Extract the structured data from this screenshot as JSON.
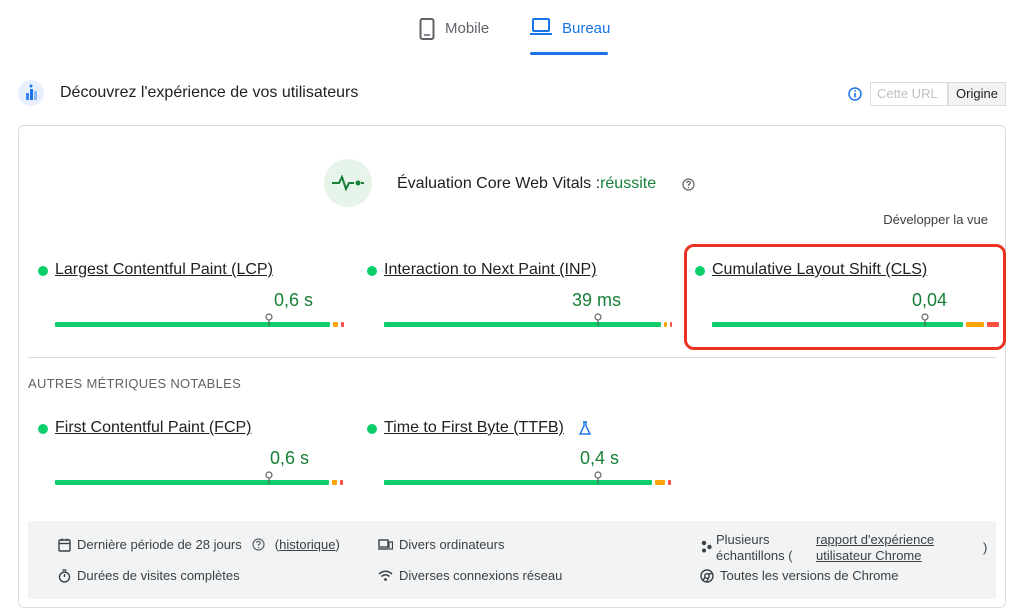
{
  "tabs": [
    {
      "label": "Mobile",
      "icon": "smartphone-icon",
      "active": false
    },
    {
      "label": "Bureau",
      "icon": "laptop-icon",
      "active": true
    }
  ],
  "section": {
    "title": "Découvrez l'expérience de vos utilisateurs",
    "toggle": {
      "url_label": "Cette URL",
      "origin_label": "Origine",
      "selected": "Origine"
    }
  },
  "cwv": {
    "label": "Évaluation Core Web Vitals :",
    "status": "réussite",
    "expand_label": "Développer la vue"
  },
  "core_metrics": [
    {
      "name": "Largest Contentful Paint (LCP)",
      "value": "0,6 s",
      "pin_fraction": 0.77
    },
    {
      "name": "Interaction to Next Paint (INP)",
      "value": "39 ms",
      "pin_fraction": 0.75
    },
    {
      "name": "Cumulative Layout Shift (CLS)",
      "value": "0,04",
      "pin_fraction": 0.74
    }
  ],
  "other_heading": "AUTRES MÉTRIQUES NOTABLES",
  "other_metrics": [
    {
      "name": "First Contentful Paint (FCP)",
      "value": "0,6 s",
      "pin_fraction": 0.77
    },
    {
      "name": "Time to First Byte (TTFB)",
      "value": "0,4 s",
      "pin_fraction": 0.74
    }
  ],
  "footer": {
    "period": "Dernière période de 28 jours",
    "history_open": "(",
    "history_link": "historique",
    "history_close": ")",
    "visit_duration": "Durées de visites complètes",
    "devices": "Divers ordinateurs",
    "network": "Diverses connexions réseau",
    "samples_line1": "Plusieurs",
    "samples_line2": "échantillons (",
    "report_line1": "rapport d'expérience",
    "report_line2": "utilisateur Chrome",
    "samples_close": ")",
    "chrome_versions": "Toutes les versions de Chrome"
  },
  "colors": {
    "good": "#0cce6b",
    "average": "#ffa400",
    "poor": "#ff4e42",
    "accent": "#1a73e8",
    "highlight": "#ea3323"
  }
}
